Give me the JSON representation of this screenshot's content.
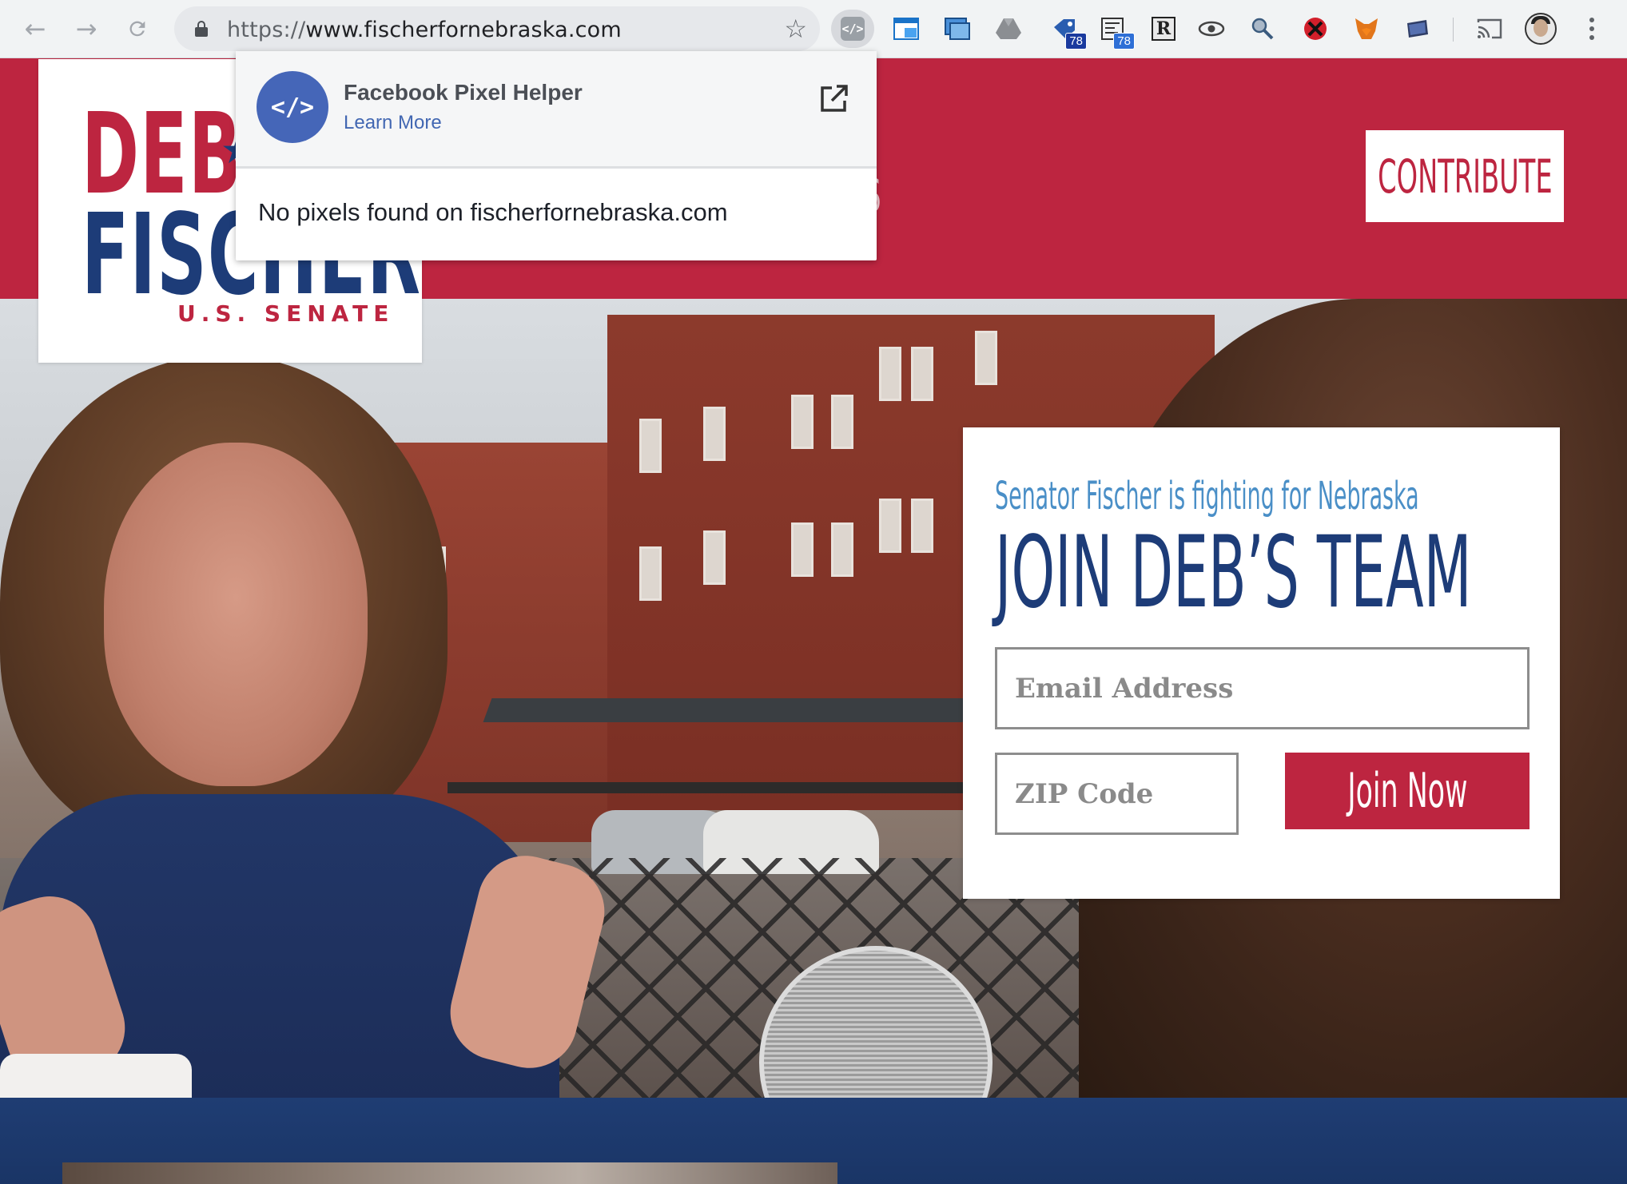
{
  "browser": {
    "url_scheme": "https://",
    "url_host": "www.fischerfornebraska.com",
    "extensions": [
      {
        "name": "facebook-pixel-helper-icon",
        "active": true
      },
      {
        "name": "window-icon"
      },
      {
        "name": "screenshot-icon"
      },
      {
        "name": "google-drive-icon"
      },
      {
        "name": "tag-icon",
        "badge": "78"
      },
      {
        "name": "network-icon",
        "badge": "78"
      },
      {
        "name": "readability-icon",
        "text": "R"
      },
      {
        "name": "eye-icon"
      },
      {
        "name": "magnifier-icon"
      },
      {
        "name": "blocker-icon"
      },
      {
        "name": "metamask-fox-icon"
      },
      {
        "name": "notes-icon"
      }
    ]
  },
  "popup": {
    "title": "Facebook Pixel Helper",
    "learn_more": "Learn More",
    "message": "No pixels found on fischerfornebraska.com",
    "logo_glyph": "</>"
  },
  "site": {
    "logo": {
      "line1": "DEB",
      "line2": "FISCHER",
      "line3": "U.S. SENATE"
    },
    "nav_partial": "TS",
    "contribute": "CONTRIBUTE",
    "signup": {
      "kicker": "Senator Fischer is fighting for Nebraska",
      "title": "JOIN DEB’S TEAM",
      "email_placeholder": "Email Address",
      "zip_placeholder": "ZIP Code",
      "button": "Join Now"
    }
  },
  "colors": {
    "brand_red": "#bd2540",
    "brand_navy": "#1d3c78",
    "accent_blue": "#4a8fc7",
    "facebook_blue": "#4267b2"
  }
}
